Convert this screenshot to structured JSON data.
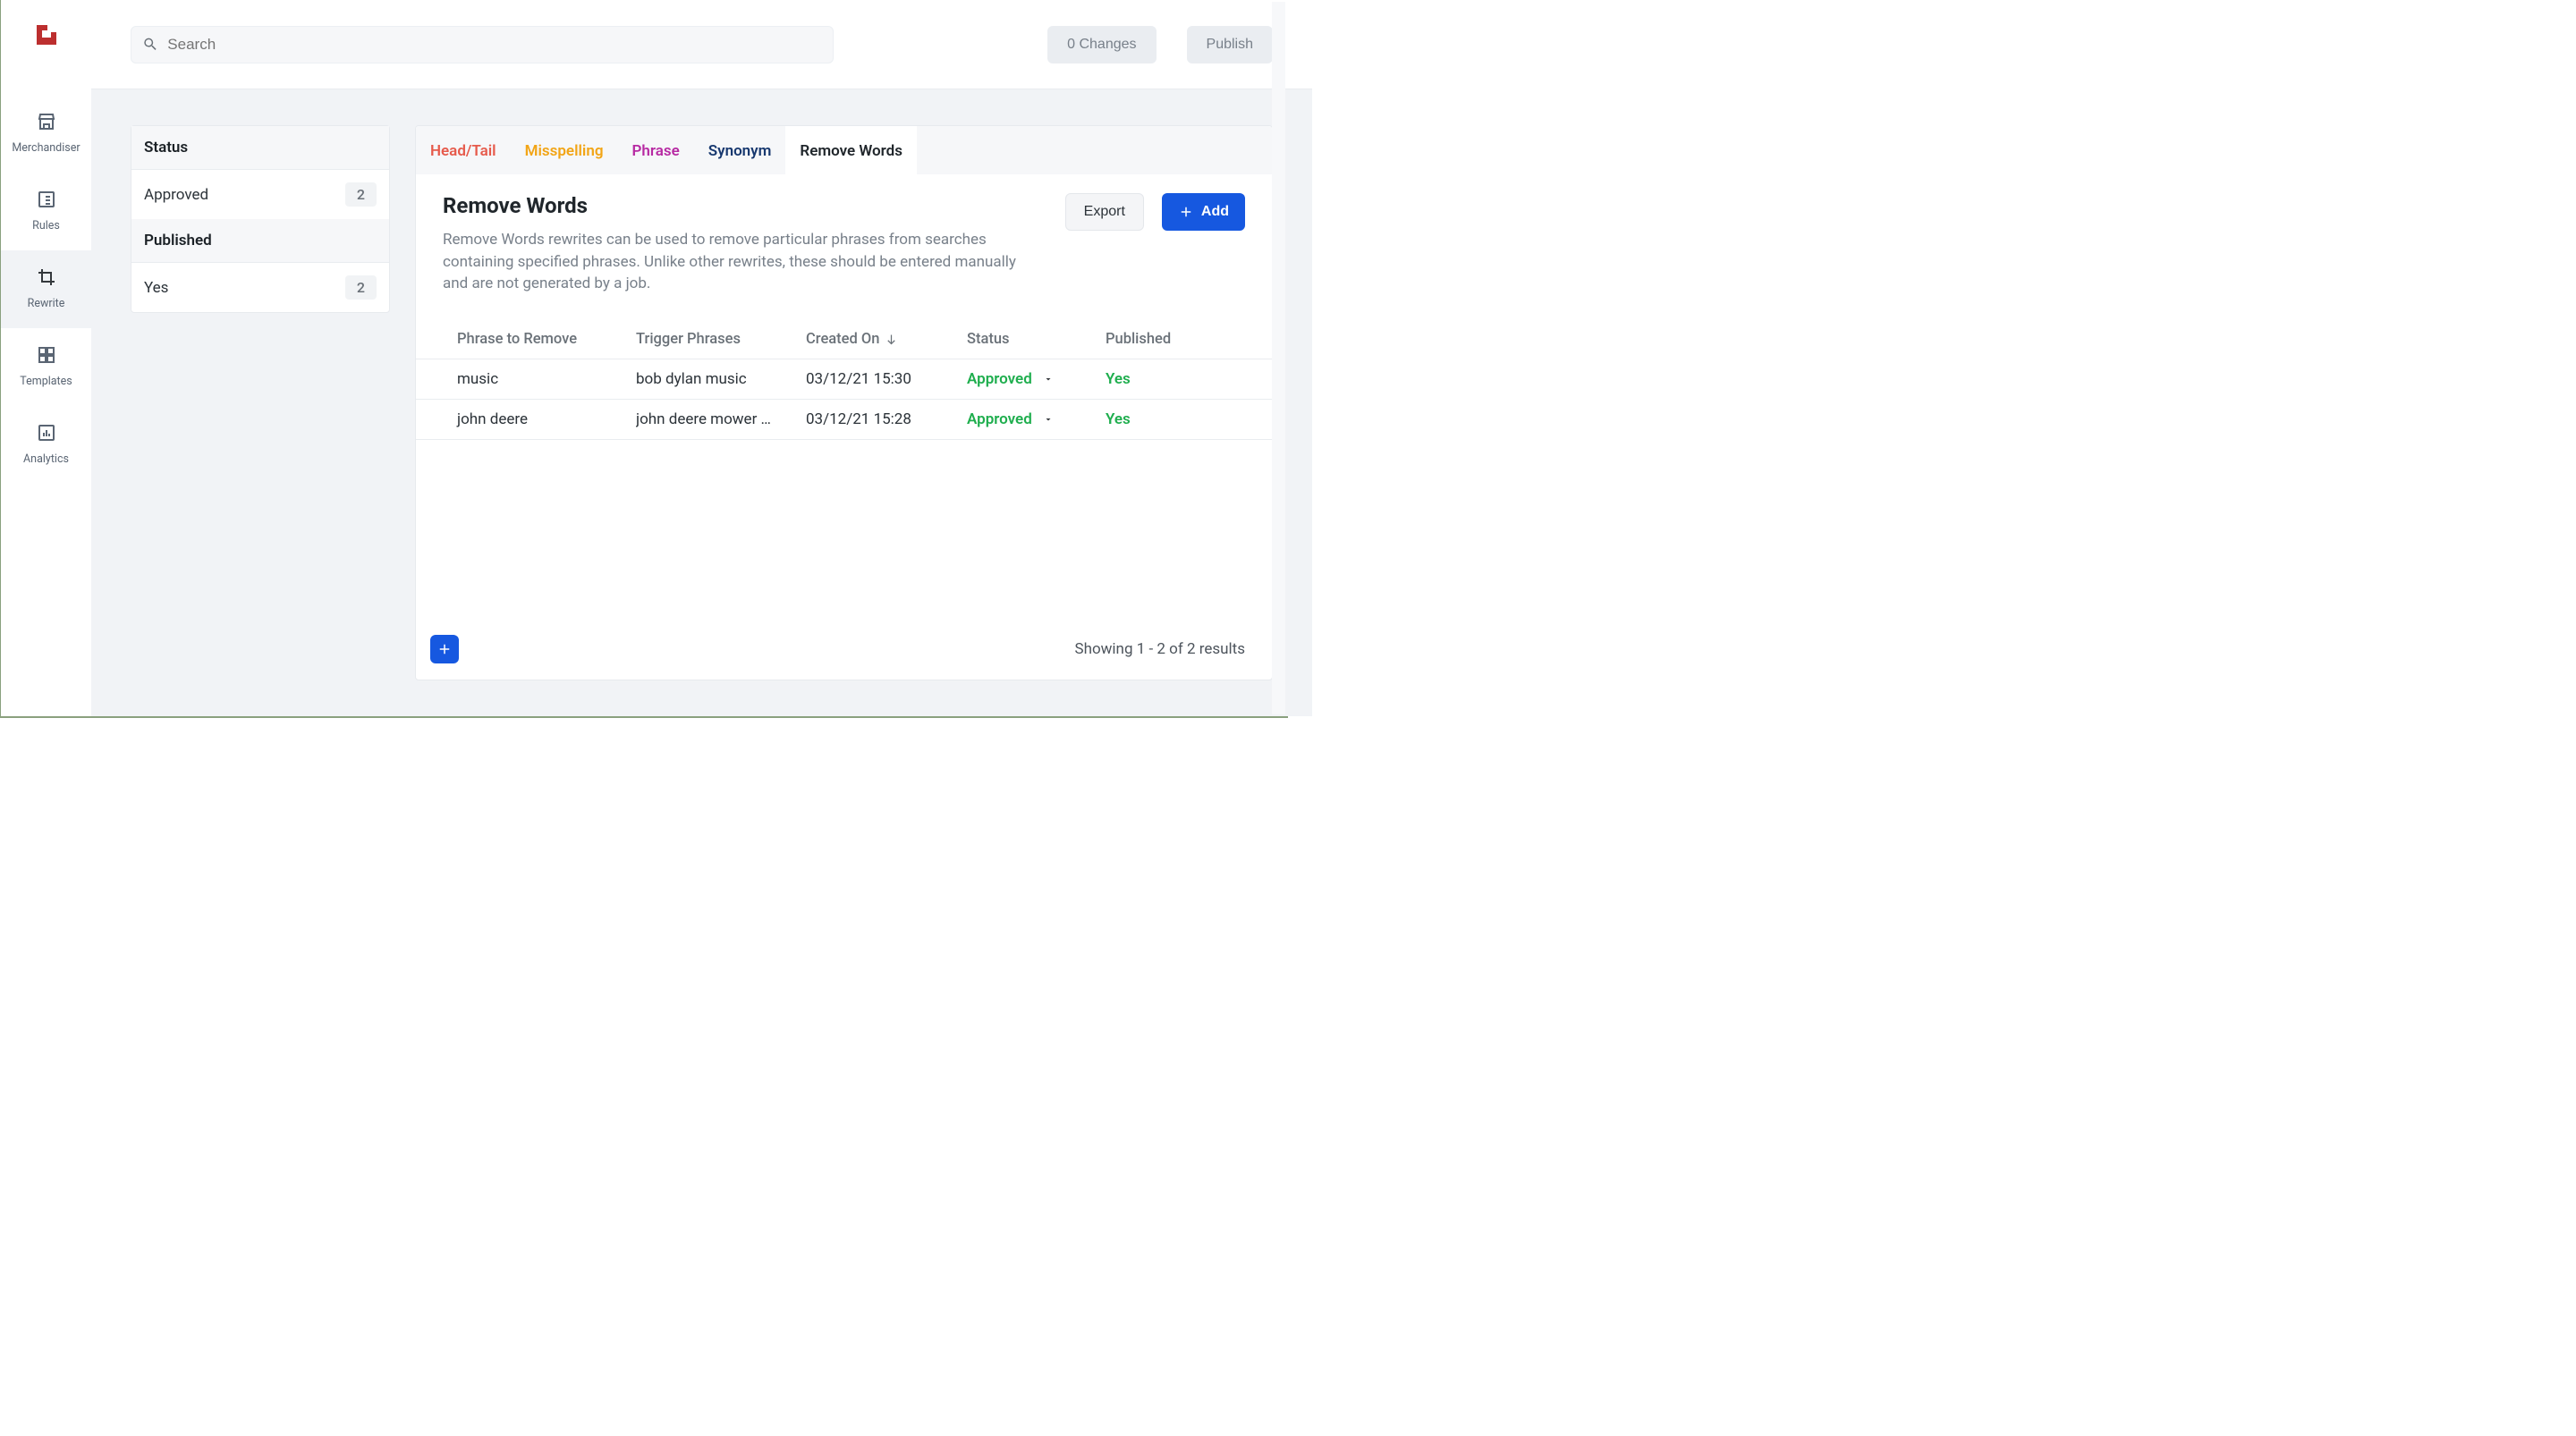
{
  "topbar": {
    "search_placeholder": "Search",
    "changes_label": "0 Changes",
    "publish_label": "Publish"
  },
  "sidebar": {
    "items": [
      {
        "label": "Merchandiser"
      },
      {
        "label": "Rules"
      },
      {
        "label": "Rewrite"
      },
      {
        "label": "Templates"
      },
      {
        "label": "Analytics"
      }
    ]
  },
  "filters": {
    "status_header": "Status",
    "status_label": "Approved",
    "status_count": "2",
    "published_header": "Published",
    "published_label": "Yes",
    "published_count": "2"
  },
  "tabs": [
    {
      "label": "Head/Tail",
      "color": "#e65a4b"
    },
    {
      "label": "Misspelling",
      "color": "#f2a516"
    },
    {
      "label": "Phrase",
      "color": "#b72aa3"
    },
    {
      "label": "Synonym",
      "color": "#17386f"
    },
    {
      "label": "Remove Words",
      "color": "#20262b",
      "active": true
    }
  ],
  "section": {
    "title": "Remove Words",
    "desc": "Remove Words rewrites can be used to remove particular phrases from searches containing specified phrases. Unlike other rewrites, these should be entered manually and are not generated by a job.",
    "export_label": "Export",
    "add_label": "Add"
  },
  "table": {
    "columns": [
      "Phrase to Remove",
      "Trigger Phrases",
      "Created On",
      "Status",
      "Published"
    ],
    "sort_col_index": 2,
    "rows": [
      {
        "phrase": "music",
        "trigger": "bob dylan music",
        "created": "03/12/21 15:30",
        "status": "Approved",
        "published": "Yes"
      },
      {
        "phrase": "john deere",
        "trigger": "john deere mower …",
        "created": "03/12/21 15:28",
        "status": "Approved",
        "published": "Yes"
      }
    ],
    "results_text": "Showing 1 - 2 of 2 results"
  }
}
